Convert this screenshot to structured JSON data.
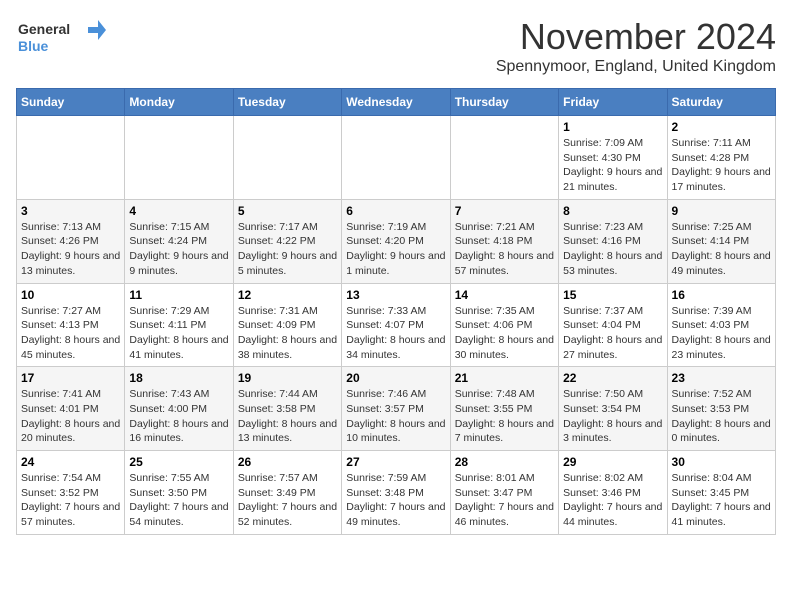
{
  "header": {
    "logo_general": "General",
    "logo_blue": "Blue",
    "main_title": "November 2024",
    "subtitle": "Spennymoor, England, United Kingdom"
  },
  "weekdays": [
    "Sunday",
    "Monday",
    "Tuesday",
    "Wednesday",
    "Thursday",
    "Friday",
    "Saturday"
  ],
  "weeks": [
    [
      {
        "day": "",
        "info": ""
      },
      {
        "day": "",
        "info": ""
      },
      {
        "day": "",
        "info": ""
      },
      {
        "day": "",
        "info": ""
      },
      {
        "day": "",
        "info": ""
      },
      {
        "day": "1",
        "info": "Sunrise: 7:09 AM\nSunset: 4:30 PM\nDaylight: 9 hours and 21 minutes."
      },
      {
        "day": "2",
        "info": "Sunrise: 7:11 AM\nSunset: 4:28 PM\nDaylight: 9 hours and 17 minutes."
      }
    ],
    [
      {
        "day": "3",
        "info": "Sunrise: 7:13 AM\nSunset: 4:26 PM\nDaylight: 9 hours and 13 minutes."
      },
      {
        "day": "4",
        "info": "Sunrise: 7:15 AM\nSunset: 4:24 PM\nDaylight: 9 hours and 9 minutes."
      },
      {
        "day": "5",
        "info": "Sunrise: 7:17 AM\nSunset: 4:22 PM\nDaylight: 9 hours and 5 minutes."
      },
      {
        "day": "6",
        "info": "Sunrise: 7:19 AM\nSunset: 4:20 PM\nDaylight: 9 hours and 1 minute."
      },
      {
        "day": "7",
        "info": "Sunrise: 7:21 AM\nSunset: 4:18 PM\nDaylight: 8 hours and 57 minutes."
      },
      {
        "day": "8",
        "info": "Sunrise: 7:23 AM\nSunset: 4:16 PM\nDaylight: 8 hours and 53 minutes."
      },
      {
        "day": "9",
        "info": "Sunrise: 7:25 AM\nSunset: 4:14 PM\nDaylight: 8 hours and 49 minutes."
      }
    ],
    [
      {
        "day": "10",
        "info": "Sunrise: 7:27 AM\nSunset: 4:13 PM\nDaylight: 8 hours and 45 minutes."
      },
      {
        "day": "11",
        "info": "Sunrise: 7:29 AM\nSunset: 4:11 PM\nDaylight: 8 hours and 41 minutes."
      },
      {
        "day": "12",
        "info": "Sunrise: 7:31 AM\nSunset: 4:09 PM\nDaylight: 8 hours and 38 minutes."
      },
      {
        "day": "13",
        "info": "Sunrise: 7:33 AM\nSunset: 4:07 PM\nDaylight: 8 hours and 34 minutes."
      },
      {
        "day": "14",
        "info": "Sunrise: 7:35 AM\nSunset: 4:06 PM\nDaylight: 8 hours and 30 minutes."
      },
      {
        "day": "15",
        "info": "Sunrise: 7:37 AM\nSunset: 4:04 PM\nDaylight: 8 hours and 27 minutes."
      },
      {
        "day": "16",
        "info": "Sunrise: 7:39 AM\nSunset: 4:03 PM\nDaylight: 8 hours and 23 minutes."
      }
    ],
    [
      {
        "day": "17",
        "info": "Sunrise: 7:41 AM\nSunset: 4:01 PM\nDaylight: 8 hours and 20 minutes."
      },
      {
        "day": "18",
        "info": "Sunrise: 7:43 AM\nSunset: 4:00 PM\nDaylight: 8 hours and 16 minutes."
      },
      {
        "day": "19",
        "info": "Sunrise: 7:44 AM\nSunset: 3:58 PM\nDaylight: 8 hours and 13 minutes."
      },
      {
        "day": "20",
        "info": "Sunrise: 7:46 AM\nSunset: 3:57 PM\nDaylight: 8 hours and 10 minutes."
      },
      {
        "day": "21",
        "info": "Sunrise: 7:48 AM\nSunset: 3:55 PM\nDaylight: 8 hours and 7 minutes."
      },
      {
        "day": "22",
        "info": "Sunrise: 7:50 AM\nSunset: 3:54 PM\nDaylight: 8 hours and 3 minutes."
      },
      {
        "day": "23",
        "info": "Sunrise: 7:52 AM\nSunset: 3:53 PM\nDaylight: 8 hours and 0 minutes."
      }
    ],
    [
      {
        "day": "24",
        "info": "Sunrise: 7:54 AM\nSunset: 3:52 PM\nDaylight: 7 hours and 57 minutes."
      },
      {
        "day": "25",
        "info": "Sunrise: 7:55 AM\nSunset: 3:50 PM\nDaylight: 7 hours and 54 minutes."
      },
      {
        "day": "26",
        "info": "Sunrise: 7:57 AM\nSunset: 3:49 PM\nDaylight: 7 hours and 52 minutes."
      },
      {
        "day": "27",
        "info": "Sunrise: 7:59 AM\nSunset: 3:48 PM\nDaylight: 7 hours and 49 minutes."
      },
      {
        "day": "28",
        "info": "Sunrise: 8:01 AM\nSunset: 3:47 PM\nDaylight: 7 hours and 46 minutes."
      },
      {
        "day": "29",
        "info": "Sunrise: 8:02 AM\nSunset: 3:46 PM\nDaylight: 7 hours and 44 minutes."
      },
      {
        "day": "30",
        "info": "Sunrise: 8:04 AM\nSunset: 3:45 PM\nDaylight: 7 hours and 41 minutes."
      }
    ]
  ]
}
